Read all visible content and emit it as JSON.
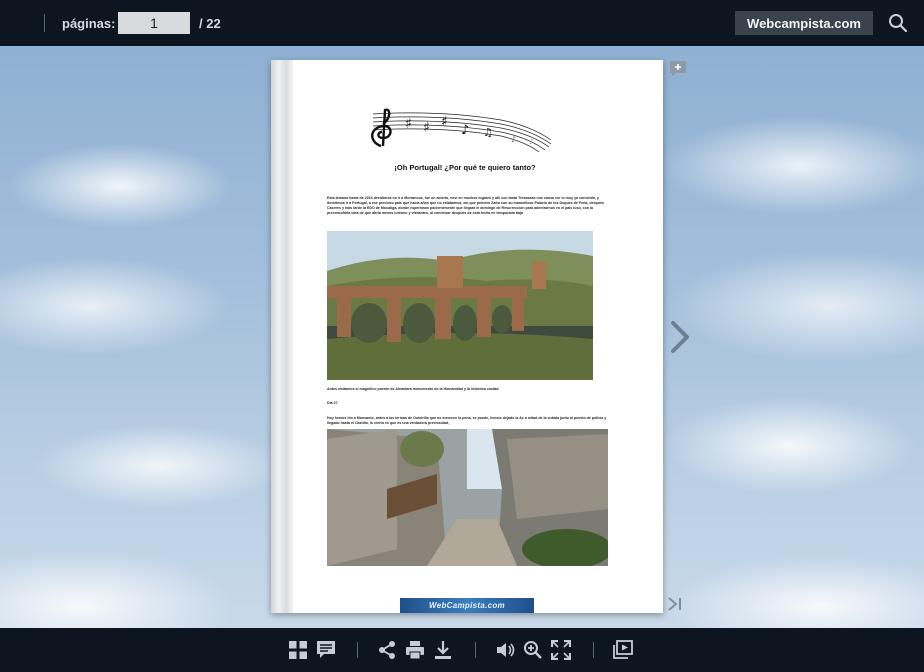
{
  "toolbar": {
    "pages_label": "páginas:",
    "page_current": "1",
    "page_total": "/ 22",
    "brand_button": "Webcampista.com",
    "search_icon": "search-icon"
  },
  "document": {
    "title": "¡Oh Portugal!   ¿Por qué te quiero tanto?",
    "paragraph_1": "Esta temana hasta de 2016 decidimos no ir a Morrancos, fue un acierto, neví en muchos lugares y allí con tanta Tresaseas nos cansa ver lo muy ya conocido, y decidimos ir a Portugal, a ese precioso país que hacía años que no estábamos, así que primero Zafra con su maravilloso Palacio de los Duques de Feria, después Cáceres y más tarde la EDO de Mocaliga, donde esperamos pacientemente que llegara el domingo de Resurrección para adentrarnos en el país luso, con la preconcebida idea de que abría menos turismo y visitantes, al comenzar después de esta fecha en temporada baja",
    "caption_1": "Antes visitamos el magnífico puente de Alcántara monumento de la Humanidad y la histórica ciudad",
    "day_label": "Día 27",
    "paragraph_2": "Hoy hemos ido a Monsanto, antes a las termas de Outeirilla que no merecen la pena, se puede, hemos dejado la Ac a mitad de la subida junto al puesto de policía y llegado hasta el Castillo, lo cierto es que es una verdadera preciosidad,",
    "footer_logo": "WebCampista.com"
  },
  "side_controls": {
    "add_note": "note-add-icon",
    "next_page": "chevron-right-icon",
    "last_page": "last-page-icon"
  },
  "bottom_toolbar": {
    "icons": [
      "thumbnails-icon",
      "notes-icon",
      "share-icon",
      "print-icon",
      "download-icon",
      "sound-icon",
      "zoom-in-icon",
      "fullscreen-icon",
      "slideshow-icon"
    ]
  },
  "colors": {
    "toolbar_bg": "#0d1620",
    "brand_button_bg": "#3a434c",
    "page_input_bg": "#d8dadd"
  }
}
